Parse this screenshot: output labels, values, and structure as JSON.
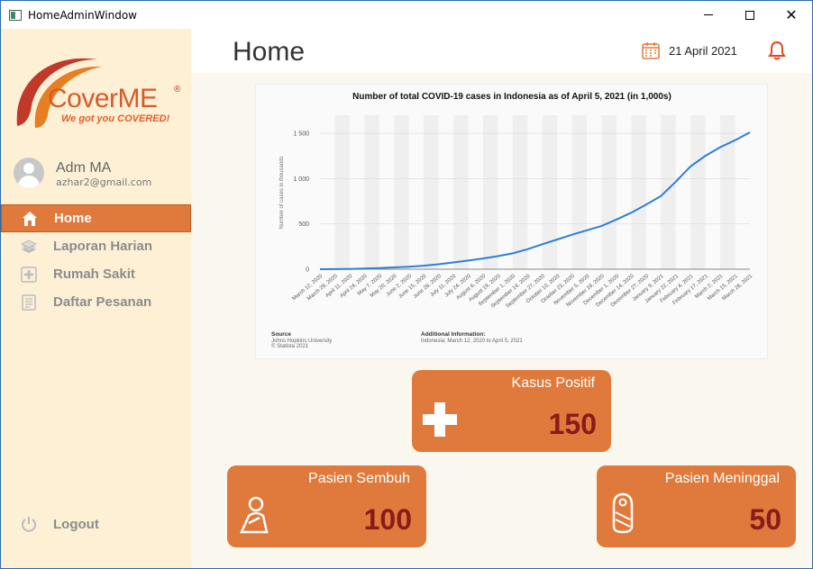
{
  "window": {
    "title": "HomeAdminWindow"
  },
  "brand": {
    "name": "CoverME",
    "registered": "®",
    "tagline": "We got you COVERED!"
  },
  "user": {
    "name": "Adm MA",
    "email": "azhar2@gmail.com"
  },
  "nav": [
    {
      "label": "Home",
      "icon": "home-icon",
      "active": true
    },
    {
      "label": "Laporan Harian",
      "icon": "report-stack-icon",
      "active": false
    },
    {
      "label": "Rumah Sakit",
      "icon": "hospital-plus-icon",
      "active": false
    },
    {
      "label": "Daftar Pesanan",
      "icon": "order-list-icon",
      "active": false
    }
  ],
  "logout": {
    "label": "Logout",
    "icon": "power-icon"
  },
  "header": {
    "title": "Home",
    "date": "21 April 2021"
  },
  "colors": {
    "accent": "#e07a3c",
    "sidebar_bg": "#fdf0d5",
    "value_text": "#8b1a1a",
    "bell": "#e04a1a",
    "line": "#2e7fd6"
  },
  "stats": {
    "positive": {
      "label": "Kasus Positif",
      "value": "150",
      "icon": "plus-cross-icon"
    },
    "recovered": {
      "label": "Pasien Sembuh",
      "value": "100",
      "icon": "recovered-person-icon"
    },
    "deceased": {
      "label": "Pasien Meninggal",
      "value": "50",
      "icon": "shrouded-body-icon"
    }
  },
  "chart_data": {
    "type": "line",
    "title": "Number of total COVID-19 cases in Indonesia as of April 5, 2021 (in 1,000s)",
    "ylabel": "Number of cases in thousands",
    "ylim": [
      0,
      1700
    ],
    "yticks": [
      "0",
      "500",
      "1 000",
      "1 500"
    ],
    "ytick_values": [
      0,
      500,
      1000,
      1500
    ],
    "grid": true,
    "categories": [
      "March 12, 2020",
      "March 28, 2020",
      "April 11, 2020",
      "April 24, 2020",
      "May 7, 2020",
      "May 20, 2020",
      "June 2, 2020",
      "June 15, 2020",
      "June 28, 2020",
      "July 11, 2020",
      "July 24, 2020",
      "August 6, 2020",
      "August 19, 2020",
      "September 1, 2020",
      "September 14, 2020",
      "September 27, 2020",
      "October 10, 2020",
      "October 23, 2020",
      "November 5, 2020",
      "November 18, 2020",
      "December 1, 2020",
      "December 14, 2020",
      "December 27, 2020",
      "January 9, 2021",
      "January 22, 2021",
      "February 4, 2021",
      "February 17, 2021",
      "March 2, 2021",
      "March 15, 2021",
      "March 28, 2021"
    ],
    "series": [
      {
        "values": [
          0,
          1,
          3,
          8,
          13,
          20,
          28,
          39,
          55,
          75,
          95,
          118,
          144,
          175,
          221,
          275,
          328,
          381,
          429,
          478,
          549,
          624,
          713,
          808,
          966,
          1135,
          1253,
          1347,
          1425,
          1511
        ]
      }
    ],
    "source_heading": "Source",
    "source_lines": [
      "Johns Hopkins University",
      "© Statista 2021"
    ],
    "info_heading": "Additional Information:",
    "info_lines": [
      "Indonesia; March 12, 2020 to April 5, 2021"
    ]
  }
}
